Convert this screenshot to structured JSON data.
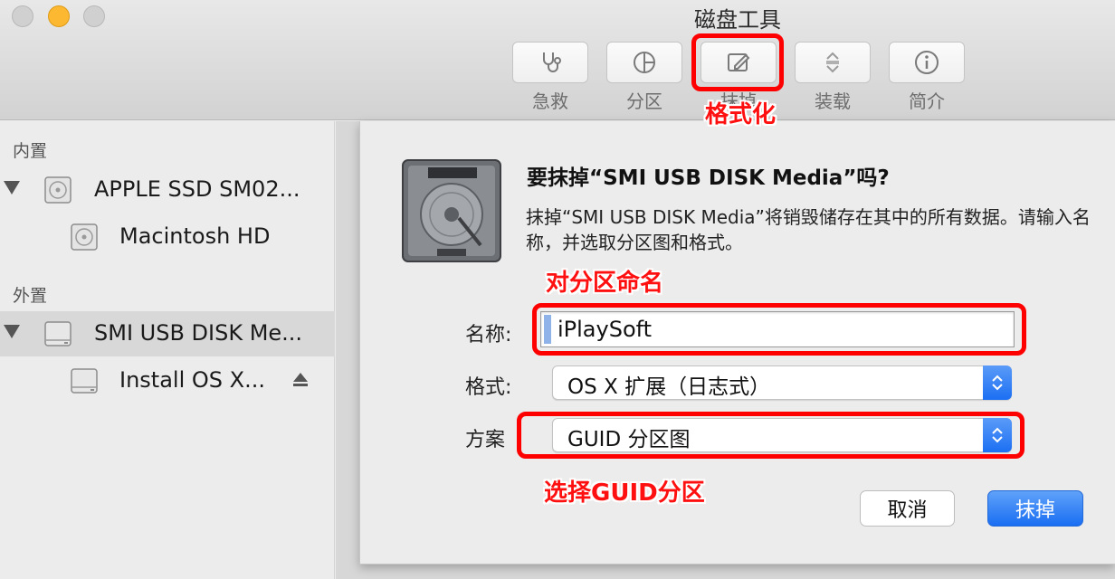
{
  "window": {
    "title": "磁盘工具"
  },
  "toolbar": {
    "buttons": [
      {
        "label": "急救",
        "icon": "stethoscope-icon"
      },
      {
        "label": "分区",
        "icon": "pie-chart-icon"
      },
      {
        "label": "抹掉",
        "icon": "erase-icon"
      },
      {
        "label": "装载",
        "icon": "mount-icon"
      },
      {
        "label": "简介",
        "icon": "info-icon"
      }
    ]
  },
  "sidebar": {
    "internal_header": "内置",
    "external_header": "外置",
    "items": [
      {
        "label": "APPLE SSD SM02...",
        "icon": "internal-disk-icon"
      },
      {
        "label": "Macintosh HD",
        "icon": "internal-volume-icon"
      },
      {
        "label": "SMI USB DISK Me...",
        "icon": "external-disk-icon"
      },
      {
        "label": "Install OS X...",
        "icon": "external-volume-icon"
      }
    ]
  },
  "dialog": {
    "title": "要抹掉“SMI USB DISK Media”吗?",
    "message": "抹掉“SMI USB DISK Media”将销毁储存在其中的所有数据。请输入名称，并选取分区图和格式。",
    "name_label": "名称:",
    "name_value": "iPlaySoft",
    "format_label": "格式:",
    "format_value": "OS X 扩展（日志式）",
    "scheme_label": "方案",
    "scheme_value": "GUID 分区图",
    "cancel_label": "取消",
    "erase_label": "抹掉"
  },
  "annotations": {
    "format_note": "格式化",
    "name_note": "对分区命名",
    "guid_note": "选择GUID分区"
  },
  "colors": {
    "annotation": "#ff0000",
    "accent": "#1c6ff3"
  }
}
